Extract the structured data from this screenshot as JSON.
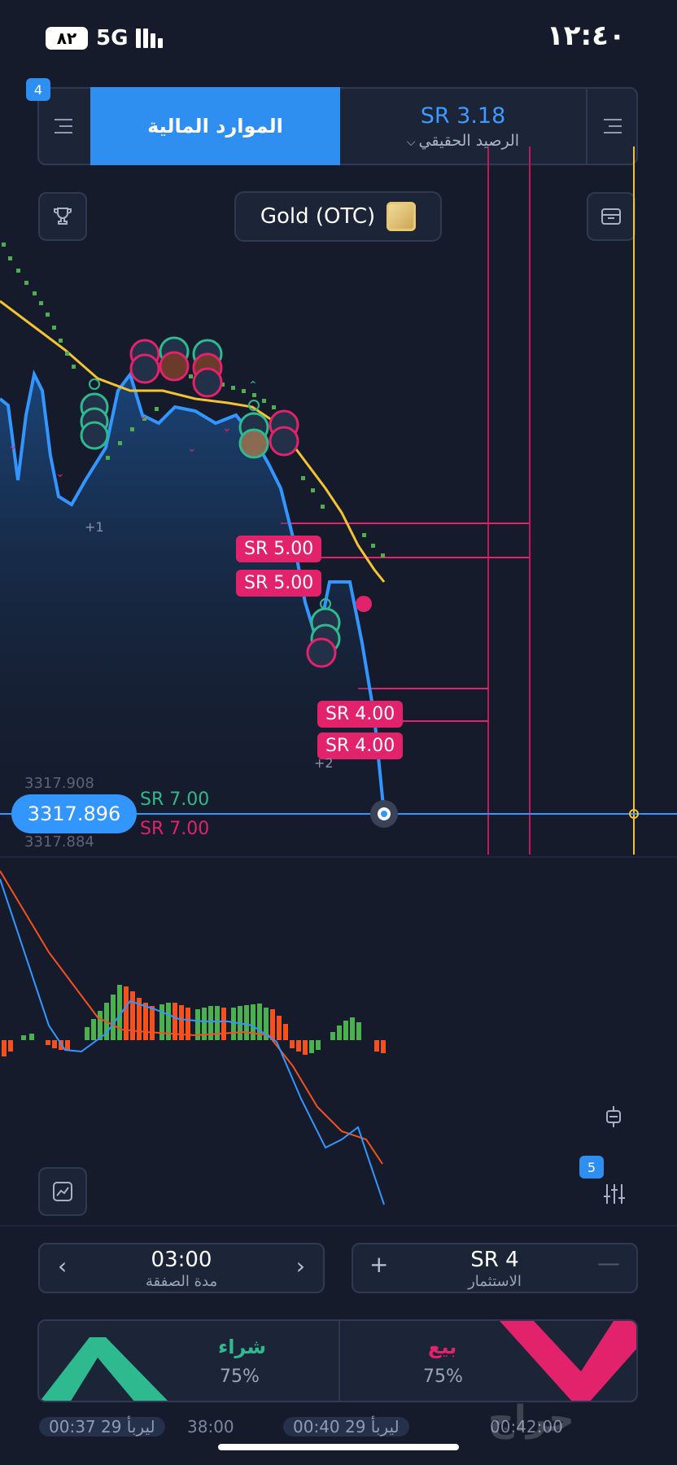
{
  "status_bar": {
    "time": "١٢:٤٠",
    "battery": "٨٢",
    "network": "5G"
  },
  "header": {
    "notification_count": "4",
    "financial_tab_label": "الموارد المالية",
    "balance_amount": "SR 3.18",
    "balance_label": "الرصيد الحقيقي"
  },
  "asset": {
    "name": "Gold (OTC)"
  },
  "chart": {
    "trade_labels": [
      "SR 5.00",
      "SR 5.00",
      "SR 4.00",
      "SR 4.00"
    ],
    "group_counts": [
      "+1",
      "+2"
    ],
    "price_ticks": [
      "3317.908",
      "3317.884"
    ],
    "current_price": "3317.896",
    "buy_amount_label": "SR 7.00",
    "sell_amount_label": "SR 7.00"
  },
  "indicator": {
    "settings_badge": "5"
  },
  "controls": {
    "duration_value": "03:00",
    "duration_label": "مدة الصفقة",
    "investment_value": "SR 4",
    "investment_label": "الاستثمار"
  },
  "trade": {
    "buy_label": "شراء",
    "buy_payout": "75%",
    "sell_label": "بيع",
    "sell_payout": "75%"
  },
  "timeline": {
    "t1": "00:37 ليربأ 29",
    "t2": "38:00",
    "t3": "00:40 ليربأ 29",
    "t4": "00:42:00"
  },
  "watermark": "حراج",
  "colors": {
    "accent_blue": "#3396ff",
    "buy_green": "#2fb98f",
    "sell_pink": "#e2226a",
    "sma_yellow": "#f4c430"
  }
}
